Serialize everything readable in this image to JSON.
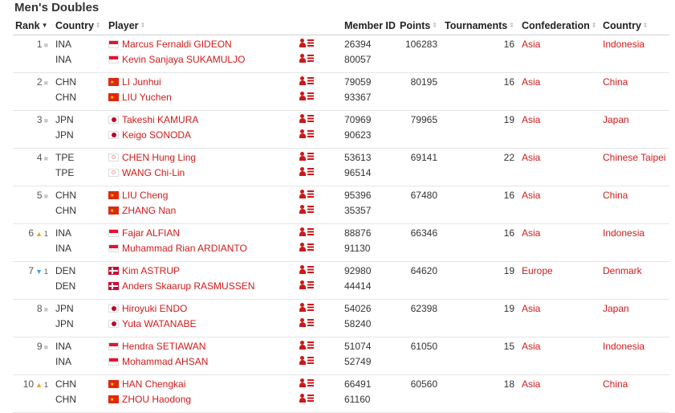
{
  "title": "Men's Doubles",
  "columns": {
    "rank": "Rank",
    "country": "Country",
    "player": "Player",
    "member_id": "Member ID",
    "points": "Points",
    "tournaments": "Tournaments",
    "confederation": "Confederation",
    "country_name": "Country"
  },
  "rows": [
    {
      "rank": "1",
      "move": "none",
      "move_by": "",
      "points": "106283",
      "tournaments": "16",
      "confederation": "Asia",
      "country_name": "Indonesia",
      "players": [
        {
          "code": "INA",
          "name": "Marcus Fernaldi GIDEON",
          "member_id": "26394"
        },
        {
          "code": "INA",
          "name": "Kevin Sanjaya SUKAMULJO",
          "member_id": "80057"
        }
      ]
    },
    {
      "rank": "2",
      "move": "none",
      "move_by": "",
      "points": "80195",
      "tournaments": "16",
      "confederation": "Asia",
      "country_name": "China",
      "players": [
        {
          "code": "CHN",
          "name": "LI Junhui",
          "member_id": "79059"
        },
        {
          "code": "CHN",
          "name": "LIU Yuchen",
          "member_id": "93367"
        }
      ]
    },
    {
      "rank": "3",
      "move": "none",
      "move_by": "",
      "points": "79965",
      "tournaments": "19",
      "confederation": "Asia",
      "country_name": "Japan",
      "players": [
        {
          "code": "JPN",
          "name": "Takeshi KAMURA",
          "member_id": "70969"
        },
        {
          "code": "JPN",
          "name": "Keigo SONODA",
          "member_id": "90623"
        }
      ]
    },
    {
      "rank": "4",
      "move": "none",
      "move_by": "",
      "points": "69141",
      "tournaments": "22",
      "confederation": "Asia",
      "country_name": "Chinese Taipei",
      "players": [
        {
          "code": "TPE",
          "name": "CHEN Hung Ling",
          "member_id": "53613"
        },
        {
          "code": "TPE",
          "name": "WANG Chi-Lin",
          "member_id": "96514"
        }
      ]
    },
    {
      "rank": "5",
      "move": "none",
      "move_by": "",
      "points": "67480",
      "tournaments": "16",
      "confederation": "Asia",
      "country_name": "China",
      "players": [
        {
          "code": "CHN",
          "name": "LIU Cheng",
          "member_id": "95396"
        },
        {
          "code": "CHN",
          "name": "ZHANG Nan",
          "member_id": "35357"
        }
      ]
    },
    {
      "rank": "6",
      "move": "up",
      "move_by": "1",
      "points": "66346",
      "tournaments": "16",
      "confederation": "Asia",
      "country_name": "Indonesia",
      "players": [
        {
          "code": "INA",
          "name": "Fajar ALFIAN",
          "member_id": "88876"
        },
        {
          "code": "INA",
          "name": "Muhammad Rian ARDIANTO",
          "member_id": "91130"
        }
      ]
    },
    {
      "rank": "7",
      "move": "down",
      "move_by": "1",
      "points": "64620",
      "tournaments": "19",
      "confederation": "Europe",
      "country_name": "Denmark",
      "players": [
        {
          "code": "DEN",
          "name": "Kim ASTRUP",
          "member_id": "92980"
        },
        {
          "code": "DEN",
          "name": "Anders Skaarup RASMUSSEN",
          "member_id": "44414"
        }
      ]
    },
    {
      "rank": "8",
      "move": "none",
      "move_by": "",
      "points": "62398",
      "tournaments": "19",
      "confederation": "Asia",
      "country_name": "Japan",
      "players": [
        {
          "code": "JPN",
          "name": "Hiroyuki ENDO",
          "member_id": "54026"
        },
        {
          "code": "JPN",
          "name": "Yuta WATANABE",
          "member_id": "58240"
        }
      ]
    },
    {
      "rank": "9",
      "move": "none",
      "move_by": "",
      "points": "61050",
      "tournaments": "15",
      "confederation": "Asia",
      "country_name": "Indonesia",
      "players": [
        {
          "code": "INA",
          "name": "Hendra SETIAWAN",
          "member_id": "51074"
        },
        {
          "code": "INA",
          "name": "Mohammad AHSAN",
          "member_id": "52749"
        }
      ]
    },
    {
      "rank": "10",
      "move": "up",
      "move_by": "1",
      "points": "60560",
      "tournaments": "18",
      "confederation": "Asia",
      "country_name": "China",
      "players": [
        {
          "code": "CHN",
          "name": "HAN Chengkai",
          "member_id": "66491"
        },
        {
          "code": "CHN",
          "name": "ZHOU Haodong",
          "member_id": "61160"
        }
      ]
    }
  ],
  "icons": {
    "sort": "sort-arrows-icon",
    "profile": "player-profile-icon",
    "move_none": "square-dot-icon",
    "move_up": "triangle-up-icon",
    "move_down": "triangle-down-icon"
  },
  "colors": {
    "link": "#d01b1b",
    "move_up": "#f0a030",
    "move_down": "#3aa8d8"
  }
}
